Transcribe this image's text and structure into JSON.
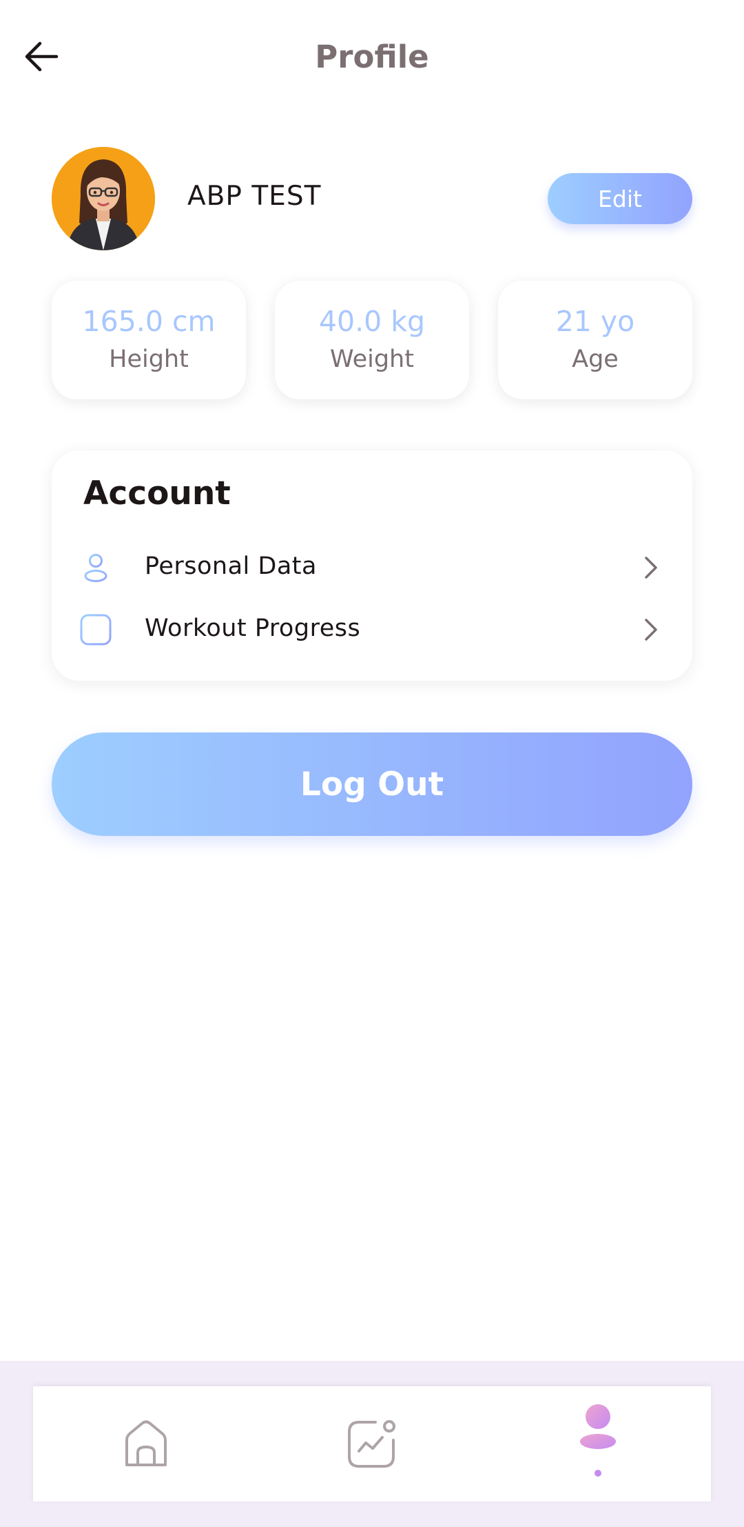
{
  "header": {
    "title": "Profile",
    "back_icon": "arrow-left-icon"
  },
  "profile": {
    "name": "ABP TEST",
    "edit_label": "Edit",
    "avatar_icon": "woman-avatar-illustration"
  },
  "stats": [
    {
      "value": "165.0 cm",
      "label": "Height"
    },
    {
      "value": "40.0 kg",
      "label": "Weight"
    },
    {
      "value": "21 yo",
      "label": "Age"
    }
  ],
  "account": {
    "title": "Account",
    "items": [
      {
        "label": "Personal Data",
        "icon": "user-icon"
      },
      {
        "label": "Workout Progress",
        "icon": "chart-icon"
      }
    ]
  },
  "logout_label": "Log Out",
  "bottom_nav": {
    "items": [
      {
        "icon": "home-icon",
        "active": false
      },
      {
        "icon": "activity-chart-icon",
        "active": false
      },
      {
        "icon": "profile-icon",
        "active": true
      }
    ]
  },
  "colors": {
    "accent_start": "#9DCEFF",
    "accent_end": "#92A3FD",
    "active_nav": "#C58BF2",
    "text_dark": "#1D1617",
    "text_gray": "#7B6F72"
  }
}
